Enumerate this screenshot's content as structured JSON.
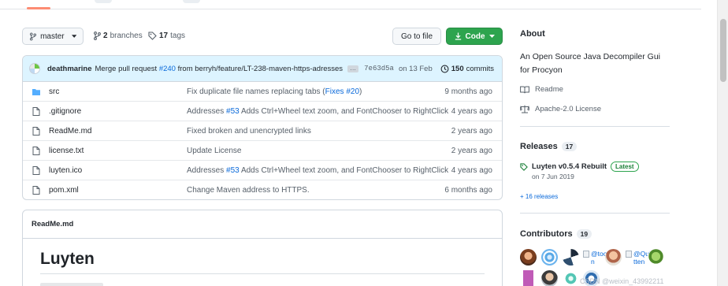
{
  "branch": {
    "name": "master",
    "branch_count": "2",
    "branch_word": "branches",
    "tag_count": "17",
    "tag_word": "tags"
  },
  "actions": {
    "goto_file": "Go to file",
    "code": "Code"
  },
  "latest_commit": {
    "author": "deathmarine",
    "message_prefix": "Merge pull request",
    "pr": "#240",
    "message_suffix": "from berryh/feature/LT-238-maven-https-adresses",
    "ellipsis": "…",
    "sha": "7e63d5a",
    "date": "on 13 Feb",
    "commit_count": "150",
    "commit_word": "commits"
  },
  "files": [
    {
      "name": "src",
      "type": "dir",
      "msg_pre": "Fix duplicate file names replacing tabs (",
      "msg_link": "Fixes",
      "msg_mid": " ",
      "msg_link2": "#20",
      "msg_post": ")",
      "age": "9 months ago"
    },
    {
      "name": ".gitignore",
      "type": "file",
      "msg_pre": "Addresses ",
      "msg_link": "#53",
      "msg_mid": "",
      "msg_link2": "",
      "msg_post": " Adds Ctrl+Wheel text zoom, and FontChooser to RightClick",
      "age": "4 years ago"
    },
    {
      "name": "ReadMe.md",
      "type": "file",
      "msg_pre": "Fixed broken and unencrypted links",
      "msg_link": "",
      "msg_mid": "",
      "msg_link2": "",
      "msg_post": "",
      "age": "2 years ago"
    },
    {
      "name": "license.txt",
      "type": "file",
      "msg_pre": "Update License",
      "msg_link": "",
      "msg_mid": "",
      "msg_link2": "",
      "msg_post": "",
      "age": "2 years ago"
    },
    {
      "name": "luyten.ico",
      "type": "file",
      "msg_pre": "Addresses ",
      "msg_link": "#53",
      "msg_mid": "",
      "msg_link2": "",
      "msg_post": " Adds Ctrl+Wheel text zoom, and FontChooser to RightClick",
      "age": "4 years ago"
    },
    {
      "name": "pom.xml",
      "type": "file",
      "msg_pre": "Change Maven address to HTTPS.",
      "msg_link": "",
      "msg_mid": "",
      "msg_link2": "",
      "msg_post": "",
      "age": "6 months ago"
    }
  ],
  "readme": {
    "filename": "ReadMe.md",
    "title": "Luyten"
  },
  "about": {
    "heading": "About",
    "description": "An Open Source Java Decompiler Gui for Procyon",
    "readme_link": "Readme",
    "license_link": "Apache-2.0 License"
  },
  "releases": {
    "heading": "Releases",
    "count": "17",
    "latest_name": "Luyten v0.5.4 Rebuilt",
    "latest_badge": "Latest",
    "latest_date": "on 7 Jun 2019",
    "more": "+ 16 releases"
  },
  "contributors": {
    "heading": "Contributors",
    "count": "19",
    "broken_1": "@toon",
    "broken_2": "@Quitten"
  },
  "colors": {
    "accent": "#0969da",
    "code_button": "#2da44e",
    "commit_bar": "#ddf4ff"
  },
  "icons": [
    "branch-icon",
    "tag-icon",
    "clock-icon",
    "folder-icon",
    "file-icon",
    "book-icon",
    "scale-icon",
    "tag-icon",
    "caret-down-icon",
    "download-icon"
  ],
  "watermark": "CSDN @weixin_43992211"
}
